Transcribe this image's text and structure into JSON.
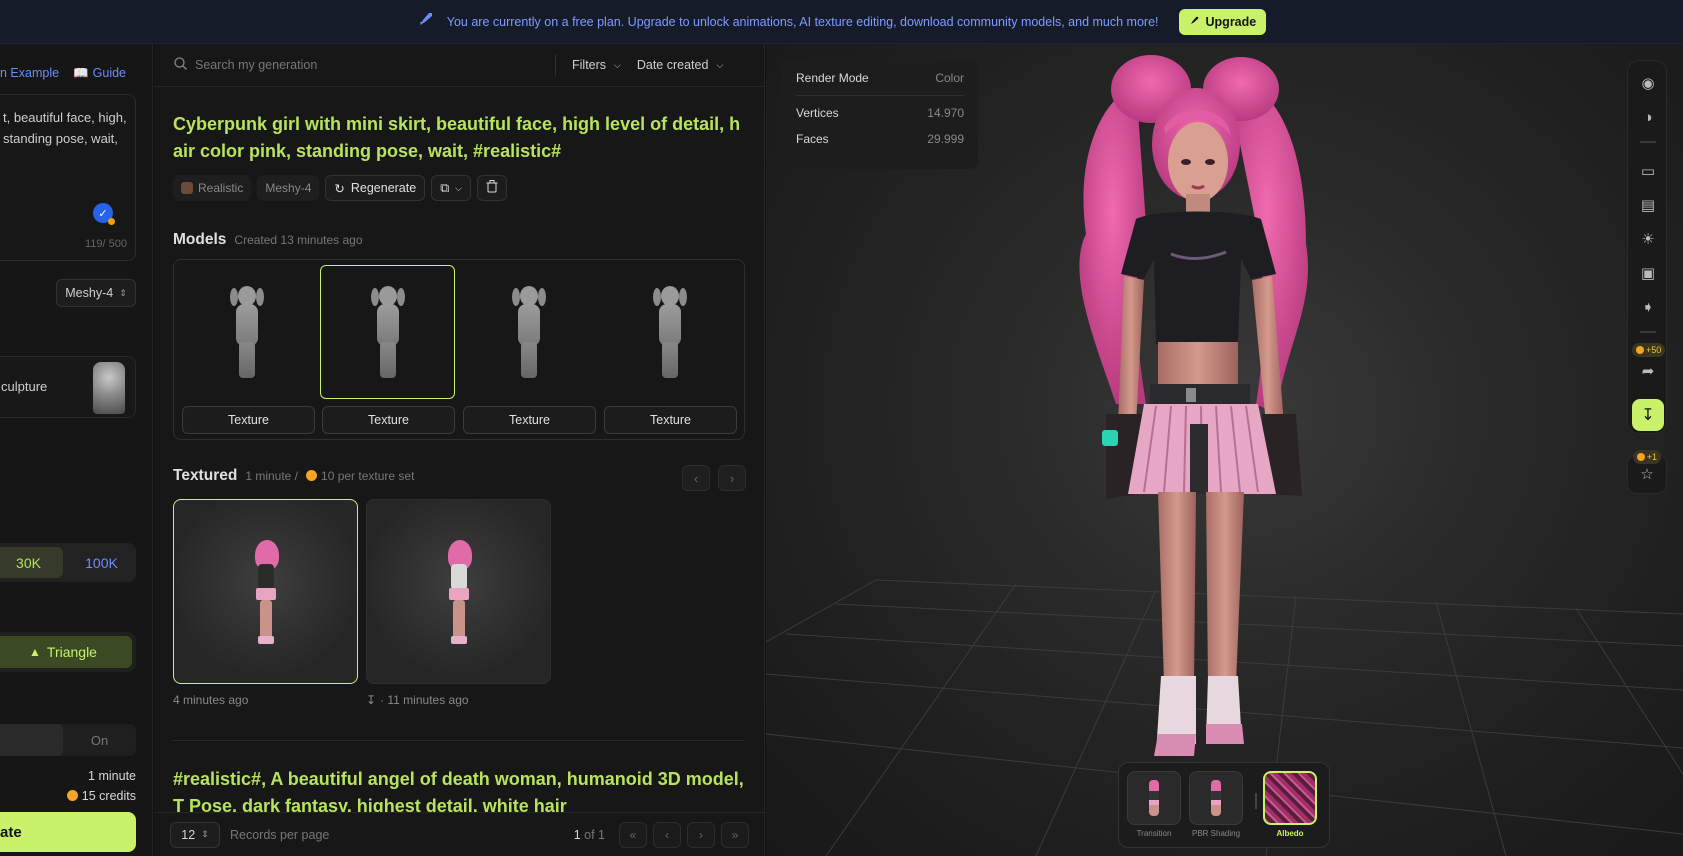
{
  "banner": {
    "message": "You are currently on a free plan. Upgrade to unlock animations, AI texture editing, download community models, and much more!",
    "upgrade_label": "Upgrade"
  },
  "left": {
    "example_link": "n Example",
    "guide_link": "Guide",
    "prompt_text": "t, beautiful face, high, standing pose, wait,",
    "char_count": "119/ 500",
    "model_select": "Meshy-4",
    "style_label": "culpture",
    "polycount": {
      "options": [
        "30K",
        "100K"
      ],
      "selected": "30K"
    },
    "topology_label": "Triangle",
    "remesh": {
      "on_label": "On"
    },
    "time_estimate": "1 minute",
    "credits": "15 credits",
    "generate_label": "ate"
  },
  "middle": {
    "search_placeholder": "Search my generation",
    "filters_label": "Filters",
    "sort_label": "Date created",
    "title": "Cyberpunk girl with mini skirt, beautiful face, high level of detail, hair color pink, standing pose, wait, #realistic#",
    "tags": {
      "style": "Realistic",
      "model": "Meshy-4"
    },
    "regenerate_label": "Regenerate",
    "models_heading": "Models",
    "models_created": "Created 13 minutes ago",
    "texture_buttons": [
      "Texture",
      "Texture",
      "Texture",
      "Texture"
    ],
    "textured_heading": "Textured",
    "textured_time": "1 minute /",
    "textured_cost": "10 per texture set",
    "textured_items": [
      {
        "caption": "4 minutes ago"
      },
      {
        "caption": "· 11 minutes ago"
      }
    ],
    "title2": "#realistic#, A beautiful angel of death woman, humanoid 3D model, T Pose, dark fantasy, highest detail, white hair",
    "pager": {
      "page_size": "12",
      "records_label": "Records per page",
      "current_page": "1",
      "of_label": "of 1"
    }
  },
  "viewport": {
    "render_mode_label": "Render Mode",
    "render_mode_value": "Color",
    "vertices_label": "Vertices",
    "vertices_value": "14.970",
    "faces_label": "Faces",
    "faces_value": "29.999",
    "share_badge": "+50",
    "feedback_badge": "+1",
    "modes": [
      {
        "label": "Transition"
      },
      {
        "label": "PBR Shading"
      },
      {
        "label": "Albedo"
      }
    ],
    "selected_mode": "Albedo"
  },
  "colors": {
    "accent": "#c9f26a",
    "link": "#6b8cff",
    "title_green": "#b8e35e"
  }
}
